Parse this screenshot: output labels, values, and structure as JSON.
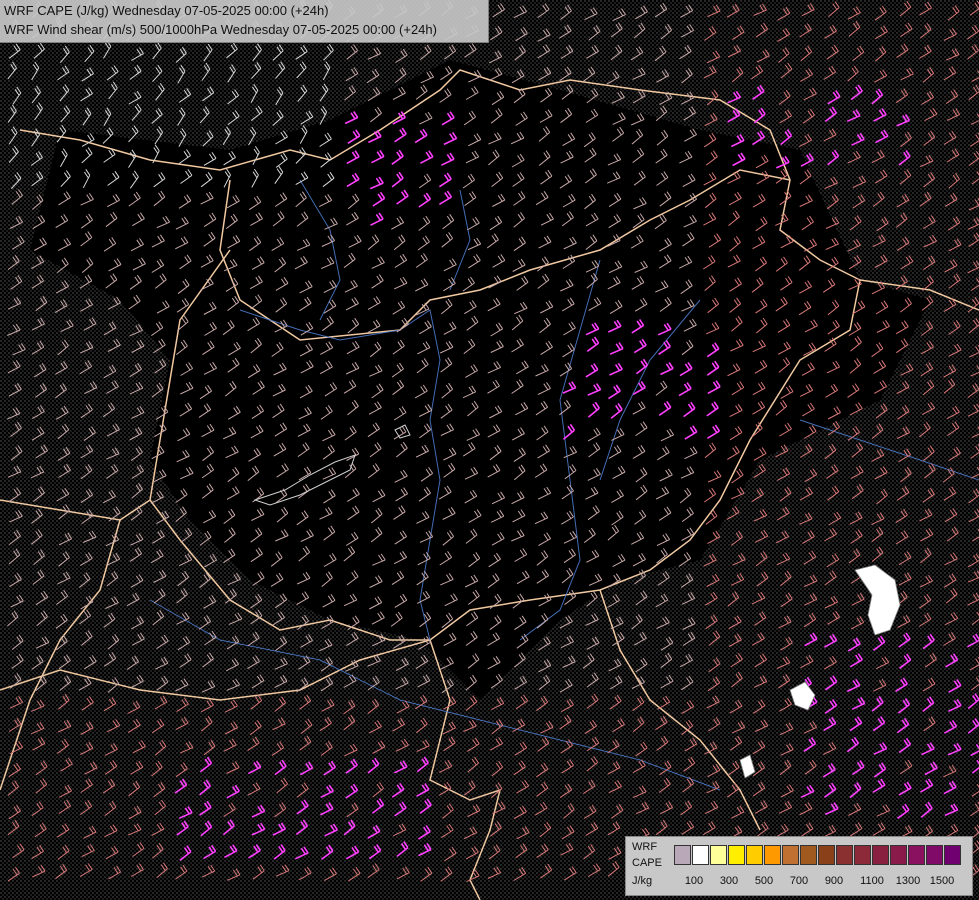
{
  "header": {
    "line1": "WRF CAPE (J/kg) Wednesday 07-05-2025 00:00 (+24h)",
    "line2": "WRF Wind shear (m/s) 500/1000hPa Wednesday 07-05-2025 00:00 (+24h)"
  },
  "legend": {
    "title_lines": [
      "WRF",
      "CAPE",
      "J/kg"
    ],
    "tick_labels": [
      "100",
      "300",
      "500",
      "700",
      "900",
      "1100",
      "1300",
      "1500"
    ],
    "colors": [
      "#b8a8b8",
      "#ffffff",
      "#ffff99",
      "#ffee00",
      "#ffcc00",
      "#ff9900",
      "#c07030",
      "#a05a20",
      "#8a4018",
      "#8a3030",
      "#8c2a3a",
      "#8a2040",
      "#8a1a4a",
      "#8a1060",
      "#800a68",
      "#700070"
    ]
  },
  "style": {
    "background": "#000000",
    "border_color": "#f0c8a0",
    "river_color": "#4a78c8",
    "barb_colors": [
      "#d8d8d8",
      "#c8a8a8",
      "#d87878",
      "#e26a6a",
      "#ff40ff"
    ]
  }
}
